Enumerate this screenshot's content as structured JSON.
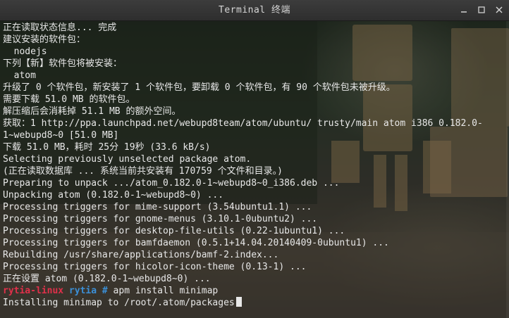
{
  "window": {
    "title": "Terminal 终端",
    "controls": [
      {
        "name": "minimize",
        "icon": "minimize-icon"
      },
      {
        "name": "maximize",
        "icon": "maximize-icon"
      },
      {
        "name": "close",
        "icon": "close-icon"
      }
    ]
  },
  "terminal": {
    "lines": [
      "正在读取状态信息... 完成",
      "建议安装的软件包：",
      "  nodejs",
      "下列【新】软件包将被安装：",
      "  atom",
      "升级了 0 个软件包，新安装了 1 个软件包，要卸载 0 个软件包，有 90 个软件包未被升级。",
      "需要下载 51.0 MB 的软件包。",
      "解压缩后会消耗掉 51.1 MB 的额外空间。",
      "获取：1 http://ppa.launchpad.net/webupd8team/atom/ubuntu/ trusty/main atom i386 0.182.0-",
      "1~webupd8~0 [51.0 MB]",
      "下载 51.0 MB，耗时 25分 19秒 (33.6 kB/s)",
      "Selecting previously unselected package atom.",
      "(正在读取数据库 ... 系统当前共安装有 170759 个文件和目录。)",
      "Preparing to unpack .../atom_0.182.0-1~webupd8~0_i386.deb ...",
      "Unpacking atom (0.182.0-1~webupd8~0) ...",
      "Processing triggers for mime-support (3.54ubuntu1.1) ...",
      "Processing triggers for gnome-menus (3.10.1-0ubuntu2) ...",
      "Processing triggers for desktop-file-utils (0.22-1ubuntu1) ...",
      "Processing triggers for bamfdaemon (0.5.1+14.04.20140409-0ubuntu1) ...",
      "Rebuilding /usr/share/applications/bamf-2.index...",
      "Processing triggers for hicolor-icon-theme (0.13-1) ...",
      "正在设置 atom (0.182.0-1~webupd8~0) ..."
    ],
    "prompt": {
      "host": "rytia-linux",
      "user": "rytia",
      "symbol": "#",
      "command": "apm install minimap"
    },
    "last_line": "Installing minimap to /root/.atom/packages"
  },
  "colors": {
    "prompt_host": "#e0304a",
    "prompt_user": "#3b8fd6",
    "text": "#e8e8e8"
  }
}
